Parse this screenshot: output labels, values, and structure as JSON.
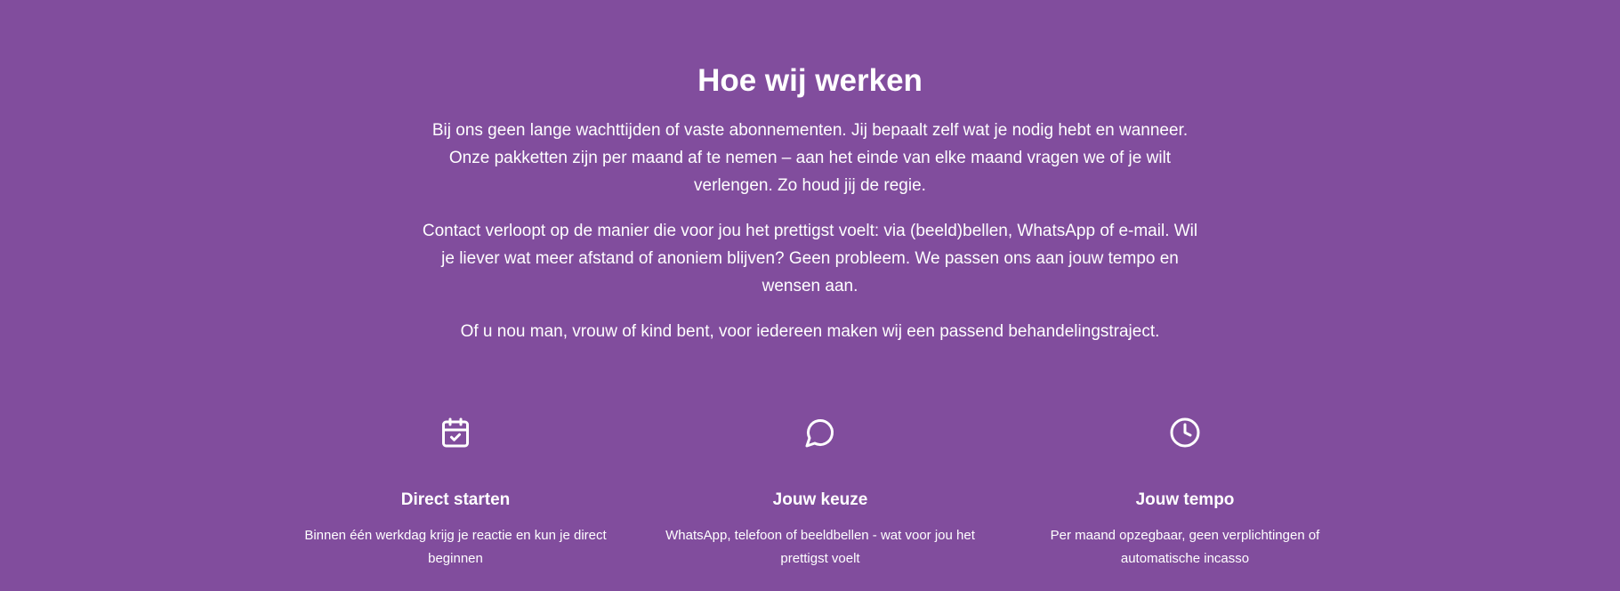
{
  "section": {
    "title": "Hoe wij werken",
    "paragraphs": [
      "Bij ons geen lange wachttijden of vaste abonnementen. Jij bepaalt zelf wat je nodig hebt en wanneer. Onze pakketten zijn per maand af te nemen – aan het einde van elke maand vragen we of je wilt verlengen. Zo houd jij de regie.",
      "Contact verloopt op de manier die voor jou het prettigst voelt: via (beeld)bellen, WhatsApp of e-mail. Wil je liever wat meer afstand of anoniem blijven? Geen probleem. We passen ons aan jouw tempo en wensen aan.",
      "Of u nou man, vrouw of kind bent, voor iedereen maken wij een passend behandelingstraject."
    ]
  },
  "features": [
    {
      "icon": "calendar-check-icon",
      "title": "Direct starten",
      "description": "Binnen één werkdag krijg je reactie en kun je direct beginnen"
    },
    {
      "icon": "chat-bubble-icon",
      "title": "Jouw keuze",
      "description": "WhatsApp, telefoon of beeldbellen - wat voor jou het prettigst voelt"
    },
    {
      "icon": "clock-icon",
      "title": "Jouw tempo",
      "description": "Per maand opzegbaar, geen verplichtingen of automatische incasso"
    }
  ],
  "colors": {
    "background": "#814D9D",
    "text": "#FFFFFF"
  }
}
